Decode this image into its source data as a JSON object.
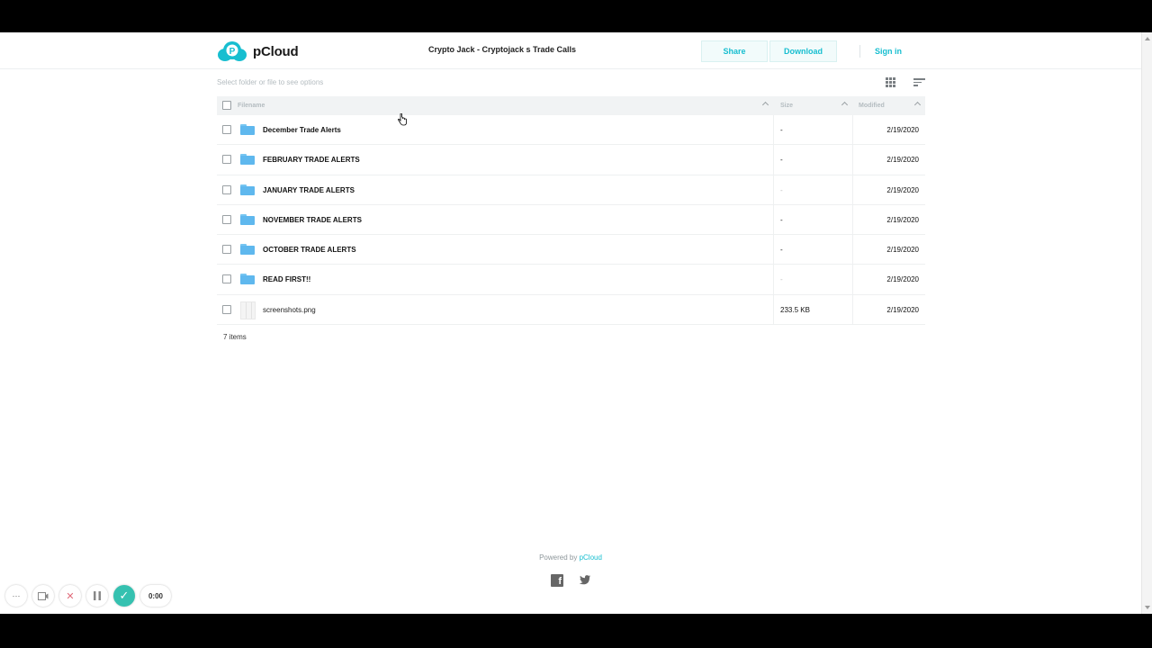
{
  "header": {
    "logo_text": "pCloud",
    "page_title": "Crypto Jack - Cryptojack s Trade Calls",
    "share_label": "Share",
    "download_label": "Download",
    "signin_label": "Sign in"
  },
  "toolbar": {
    "hint": "Select folder or file to see options",
    "grid_icon": "grid-view-icon",
    "sort_icon": "sort-icon"
  },
  "table": {
    "columns": {
      "filename": "Filename",
      "size": "Size",
      "modified": "Modified"
    },
    "rows": [
      {
        "name": "December Trade Alerts",
        "type": "folder",
        "size": "-",
        "modified": "2/19/2020"
      },
      {
        "name": "FEBRUARY TRADE ALERTS",
        "type": "folder",
        "size": "-",
        "modified": "2/19/2020"
      },
      {
        "name": "JANUARY TRADE ALERTS",
        "type": "folder",
        "size": "-",
        "modified": "2/19/2020"
      },
      {
        "name": "NOVEMBER TRADE ALERTS",
        "type": "folder",
        "size": "-",
        "modified": "2/19/2020"
      },
      {
        "name": "OCTOBER TRADE ALERTS",
        "type": "folder",
        "size": "-",
        "modified": "2/19/2020"
      },
      {
        "name": "READ FIRST!!",
        "type": "folder",
        "size": "-",
        "modified": "2/19/2020"
      },
      {
        "name": "screenshots.png",
        "type": "file",
        "size": "233.5 KB",
        "modified": "2/19/2020"
      }
    ],
    "count": "7 items"
  },
  "footer": {
    "powered_prefix": "Powered by",
    "powered_link": "pCloud"
  },
  "recorder": {
    "more_label": "···",
    "time": "0:00"
  },
  "colors": {
    "accent": "#17bed0",
    "folder": "#5fb8ee",
    "confirm": "#35c1b0"
  }
}
